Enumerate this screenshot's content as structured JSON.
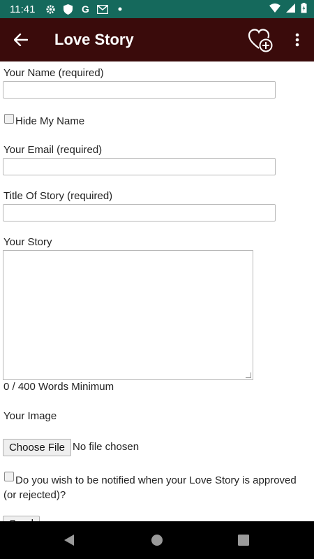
{
  "status_bar": {
    "time": "11:41",
    "icons": [
      "settings-icon",
      "shield-icon",
      "google-icon",
      "gmail-icon",
      "dot-icon",
      "wifi-icon",
      "signal-icon",
      "battery-icon"
    ],
    "g_letter": "G",
    "bg_color": "#15695c"
  },
  "app_bar": {
    "title": "Love Story",
    "bg_color": "#3a0b0b"
  },
  "form": {
    "name_label": "Your Name (required)",
    "name_value": "",
    "hide_name_label": "Hide My Name",
    "email_label": "Your Email (required)",
    "email_value": "",
    "title_label": "Title Of Story (required)",
    "title_value": "",
    "story_label": "Your Story",
    "story_value": "",
    "word_count": "0 / 400 Words Minimum",
    "image_label": "Your Image",
    "choose_file_label": "Choose File",
    "no_file_text": "No file chosen",
    "notify_label": "Do you wish to be notified when your Love Story is approved (or rejected)?",
    "send_label": "Send"
  }
}
